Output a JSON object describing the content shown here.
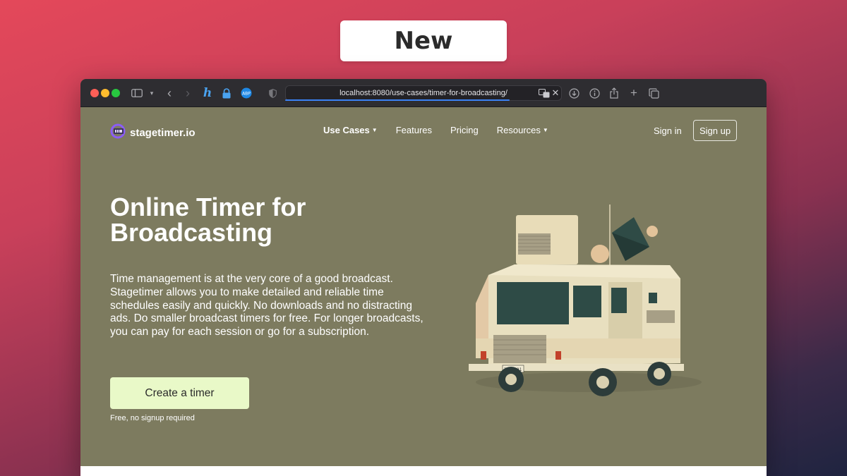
{
  "badge": {
    "label": "New"
  },
  "browser": {
    "url": "localhost:8080/use-cases/timer-for-broadcasting/",
    "icons": [
      "sidebar-icon",
      "chevron-down-icon",
      "back-icon",
      "forward-icon",
      "honey-icon",
      "lock-icon",
      "adblock-icon",
      "shield-icon",
      "translate-icon",
      "close-icon",
      "download-icon",
      "info-icon",
      "share-icon",
      "plus-icon",
      "tabs-icon"
    ],
    "adblock_label": "ABP"
  },
  "nav": {
    "logo": "stagetimer.io",
    "links": [
      {
        "label": "Use Cases",
        "dropdown": true,
        "bold": true
      },
      {
        "label": "Features",
        "dropdown": false
      },
      {
        "label": "Pricing",
        "dropdown": false
      },
      {
        "label": "Resources",
        "dropdown": true
      }
    ],
    "signin": "Sign in",
    "signup": "Sign up"
  },
  "hero": {
    "title": "Online Timer for Broadcasting",
    "description": "Time management is at the very core of a good broadcast. Stagetimer allows you to make detailed and reliable time schedules easily and quickly. No downloads and no distracting ads. Do smaller broadcast timers for free. For longer broadcasts, you can pay for each session or go for a subscription.",
    "cta": "Create a timer",
    "cta_note": "Free, no signup required",
    "plate": "TU2 021"
  },
  "colors": {
    "page_bg": "#7d7b5f",
    "cta_bg": "#e9f9c8",
    "toolbar_bg": "#2e2d31",
    "accent": "#3b82f6"
  }
}
